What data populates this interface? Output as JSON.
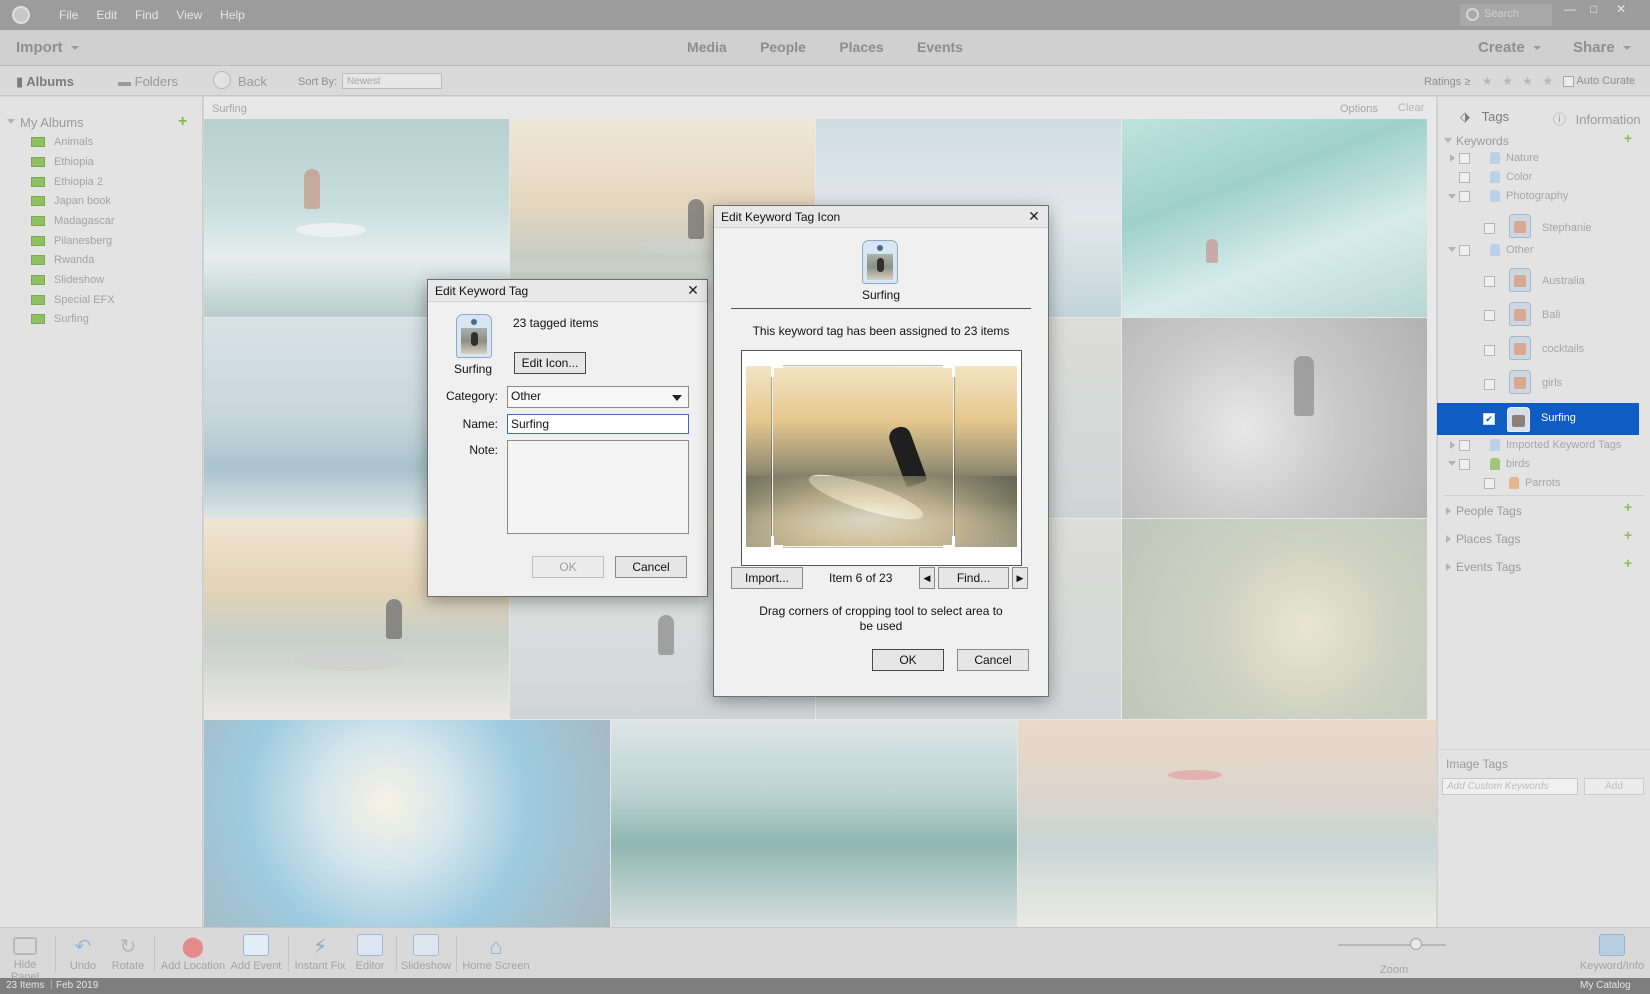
{
  "menu": [
    "File",
    "Edit",
    "Find",
    "View",
    "Help"
  ],
  "search_placeholder": "Search",
  "toolbar": {
    "import": "Import",
    "nav": [
      "Media",
      "People",
      "Places",
      "Events"
    ],
    "create": "Create",
    "share": "Share"
  },
  "subbar": {
    "albums_tab": "Albums",
    "folders_tab": "Folders",
    "back": "Back",
    "sort_by_label": "Sort By:",
    "sort_value": "Newest",
    "ratings_label": "Ratings ≥",
    "stars": "★ ★ ★ ★ ★",
    "auto_curate": "Auto Curate"
  },
  "left_panel": {
    "heading": "My Albums",
    "albums": [
      "Animals",
      "Ethiopia",
      "Ethiopia 2",
      "Japan book",
      "Madagascar",
      "Pilanesberg",
      "Rwanda",
      "Slideshow",
      "Special EFX",
      "Surfing"
    ]
  },
  "content": {
    "breadcrumb": "Surfing",
    "options": "Options",
    "clear": "Clear"
  },
  "right_panel": {
    "tabs": {
      "tags": "Tags",
      "information": "Information"
    },
    "keywords_heading": "Keywords",
    "keywords": {
      "nature": "Nature",
      "color": "Color",
      "photography": "Photography",
      "stephanie": "Stephanie",
      "other": "Other",
      "australia": "Australia",
      "bali": "Bali",
      "cocktails": "cocktails",
      "girls": "girls",
      "surfing": "Surfing",
      "imported": "Imported Keyword Tags",
      "birds": "birds",
      "parrots": "Parrots"
    },
    "sections": [
      "People Tags",
      "Places Tags",
      "Events Tags"
    ],
    "image_tags_heading": "Image Tags",
    "image_tags_placeholder": "Add Custom Keywords",
    "add_button": "Add"
  },
  "bottom_bar": {
    "items": [
      "Hide Panel",
      "Undo",
      "Rotate",
      "Add Location",
      "Add Event",
      "Instant Fix",
      "Editor",
      "Slideshow",
      "Home Screen"
    ],
    "zoom": "Zoom",
    "keyword_info": "Keyword/Info"
  },
  "status": {
    "items": "23 Items",
    "date": "Feb 2019",
    "catalog": "My Catalog"
  },
  "edit_tag_dialog": {
    "title": "Edit Keyword Tag",
    "tagged_items": "23 tagged items",
    "icon_caption": "Surfing",
    "edit_icon_button": "Edit Icon...",
    "category_label": "Category:",
    "category_value": "Other",
    "name_label": "Name:",
    "name_value": "Surfing",
    "note_label": "Note:",
    "ok": "OK",
    "cancel": "Cancel"
  },
  "edit_icon_dialog": {
    "title": "Edit Keyword Tag Icon",
    "icon_caption": "Surfing",
    "assigned_text": "This keyword tag has been assigned to 23 items",
    "import_button": "Import...",
    "item_counter": "Item 6 of 23",
    "find_button": "Find...",
    "instructions": "Drag corners of cropping tool to select area to be used",
    "ok": "OK",
    "cancel": "Cancel"
  },
  "colors": {
    "selection": "#0f5cc4",
    "accent_green": "#8ec159",
    "chrome_dark": "#9c9c9c"
  }
}
